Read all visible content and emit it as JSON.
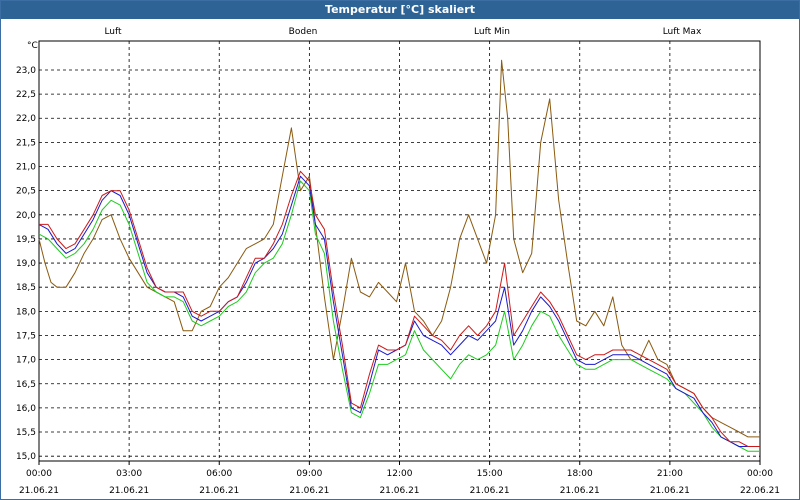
{
  "window": {
    "title": "Temperatur [°C] skaliert"
  },
  "colors": {
    "luft": "#1a1acc",
    "boden": "#8a5a10",
    "luft_min": "#1ecc1e",
    "luft_max": "#cc1a1a",
    "grid": "#000000",
    "title_bar": "#2e6396"
  },
  "chart_data": {
    "type": "line",
    "title": "Temperatur [°C] skaliert",
    "ylabel": "°C",
    "xlabel": "",
    "ylim": [
      14.9,
      23.6
    ],
    "xlim": [
      0,
      24
    ],
    "grid": true,
    "legend": "top",
    "y_ticks": [
      "15,0",
      "15,5",
      "16,0",
      "16,5",
      "17,0",
      "17,5",
      "18,0",
      "18,5",
      "19,0",
      "19,5",
      "20,0",
      "20,5",
      "21,0",
      "21,5",
      "22,0",
      "22,5",
      "23,0"
    ],
    "y_tick_values": [
      15,
      15.5,
      16,
      16.5,
      17,
      17.5,
      18,
      18.5,
      19,
      19.5,
      20,
      20.5,
      21,
      21.5,
      22,
      22.5,
      23
    ],
    "x_ticks": [
      {
        "value": 0,
        "time": "00:00",
        "date": "21.06.21"
      },
      {
        "value": 3,
        "time": "03:00",
        "date": "21.06.21"
      },
      {
        "value": 6,
        "time": "06:00",
        "date": "21.06.21"
      },
      {
        "value": 9,
        "time": "09:00",
        "date": "21.06.21"
      },
      {
        "value": 12,
        "time": "12:00",
        "date": "21.06.21"
      },
      {
        "value": 15,
        "time": "15:00",
        "date": "21.06.21"
      },
      {
        "value": 18,
        "time": "18:00",
        "date": "21.06.21"
      },
      {
        "value": 21,
        "time": "21:00",
        "date": "21.06.21"
      },
      {
        "value": 24,
        "time": "00:00",
        "date": "22.06.21"
      }
    ],
    "series": [
      {
        "name": "Luft",
        "key": "luft",
        "x": [
          0,
          0.3,
          0.6,
          0.9,
          1.2,
          1.5,
          1.8,
          2.1,
          2.4,
          2.7,
          3.0,
          3.3,
          3.6,
          3.9,
          4.2,
          4.5,
          4.8,
          5.1,
          5.4,
          5.7,
          6.0,
          6.3,
          6.6,
          6.9,
          7.2,
          7.5,
          7.8,
          8.1,
          8.4,
          8.7,
          9.0,
          9.2,
          9.5,
          9.8,
          10.1,
          10.4,
          10.7,
          11.0,
          11.3,
          11.6,
          11.9,
          12.2,
          12.5,
          12.8,
          13.1,
          13.4,
          13.7,
          14.0,
          14.3,
          14.6,
          14.9,
          15.2,
          15.5,
          15.8,
          16.1,
          16.4,
          16.7,
          17.0,
          17.3,
          17.6,
          17.9,
          18.2,
          18.5,
          18.8,
          19.1,
          19.4,
          19.7,
          20.0,
          20.3,
          20.6,
          20.9,
          21.2,
          21.5,
          21.8,
          22.1,
          22.4,
          22.7,
          23.0,
          23.3,
          23.6,
          24.0
        ],
        "values": [
          19.8,
          19.7,
          19.4,
          19.2,
          19.3,
          19.6,
          19.9,
          20.3,
          20.5,
          20.4,
          20.0,
          19.4,
          18.8,
          18.5,
          18.4,
          18.4,
          18.3,
          17.9,
          17.8,
          17.9,
          18.0,
          18.2,
          18.3,
          18.6,
          19.0,
          19.1,
          19.3,
          19.6,
          20.2,
          20.8,
          20.6,
          19.8,
          19.5,
          18.2,
          17.1,
          16.0,
          15.9,
          16.5,
          17.2,
          17.1,
          17.2,
          17.3,
          17.8,
          17.5,
          17.4,
          17.3,
          17.1,
          17.3,
          17.5,
          17.4,
          17.6,
          17.8,
          18.5,
          17.3,
          17.6,
          18.0,
          18.3,
          18.1,
          17.8,
          17.4,
          17.0,
          16.9,
          16.9,
          17.0,
          17.1,
          17.1,
          17.1,
          17.0,
          16.9,
          16.8,
          16.7,
          16.4,
          16.3,
          16.2,
          15.9,
          15.7,
          15.4,
          15.3,
          15.2,
          15.2,
          15.2
        ]
      },
      {
        "name": "Boden",
        "key": "boden",
        "x": [
          0,
          0.2,
          0.4,
          0.6,
          0.9,
          1.2,
          1.5,
          1.8,
          2.1,
          2.4,
          2.7,
          3.0,
          3.3,
          3.6,
          3.9,
          4.2,
          4.5,
          4.8,
          5.1,
          5.4,
          5.7,
          6.0,
          6.3,
          6.6,
          6.9,
          7.2,
          7.5,
          7.8,
          8.1,
          8.4,
          8.7,
          9.0,
          9.2,
          9.5,
          9.8,
          10.1,
          10.4,
          10.7,
          11.0,
          11.3,
          11.6,
          11.9,
          12.2,
          12.5,
          12.8,
          13.1,
          13.4,
          13.7,
          14.0,
          14.3,
          14.6,
          14.9,
          15.2,
          15.4,
          15.6,
          15.8,
          16.1,
          16.4,
          16.7,
          17.0,
          17.3,
          17.6,
          17.9,
          18.2,
          18.5,
          18.8,
          19.1,
          19.4,
          19.7,
          20.0,
          20.3,
          20.6,
          20.9,
          21.2,
          21.5,
          21.8,
          22.1,
          22.4,
          22.7,
          23.0,
          23.3,
          23.6,
          24.0
        ],
        "values": [
          19.5,
          19.0,
          18.6,
          18.5,
          18.5,
          18.8,
          19.2,
          19.5,
          19.9,
          20.0,
          19.5,
          19.1,
          18.8,
          18.5,
          18.4,
          18.3,
          18.2,
          17.6,
          17.6,
          18.0,
          18.1,
          18.5,
          18.7,
          19.0,
          19.3,
          19.4,
          19.5,
          19.8,
          20.8,
          21.8,
          20.5,
          20.8,
          19.8,
          18.3,
          17.0,
          18.0,
          19.1,
          18.4,
          18.3,
          18.6,
          18.4,
          18.2,
          19.0,
          18.0,
          17.8,
          17.5,
          17.8,
          18.5,
          19.5,
          20.0,
          19.5,
          19.0,
          20.0,
          23.2,
          22.0,
          19.5,
          18.8,
          19.2,
          21.5,
          22.4,
          20.3,
          19.0,
          17.8,
          17.7,
          18.0,
          17.7,
          18.3,
          17.3,
          17.0,
          17.0,
          17.4,
          17.0,
          16.9,
          16.5,
          16.4,
          16.3,
          16.0,
          15.8,
          15.7,
          15.6,
          15.5,
          15.4,
          15.4
        ]
      },
      {
        "name": "Luft Min",
        "key": "luft_min",
        "x": [
          0,
          0.3,
          0.6,
          0.9,
          1.2,
          1.5,
          1.8,
          2.1,
          2.4,
          2.7,
          3.0,
          3.3,
          3.6,
          3.9,
          4.2,
          4.5,
          4.8,
          5.1,
          5.4,
          5.7,
          6.0,
          6.3,
          6.6,
          6.9,
          7.2,
          7.5,
          7.8,
          8.1,
          8.4,
          8.7,
          9.0,
          9.2,
          9.5,
          9.8,
          10.1,
          10.4,
          10.7,
          11.0,
          11.3,
          11.6,
          11.9,
          12.2,
          12.5,
          12.8,
          13.1,
          13.4,
          13.7,
          14.0,
          14.3,
          14.6,
          14.9,
          15.2,
          15.5,
          15.8,
          16.1,
          16.4,
          16.7,
          17.0,
          17.3,
          17.6,
          17.9,
          18.2,
          18.5,
          18.8,
          19.1,
          19.4,
          19.7,
          20.0,
          20.3,
          20.6,
          20.9,
          21.2,
          21.5,
          21.8,
          22.1,
          22.4,
          22.7,
          23.0,
          23.3,
          23.6,
          24.0
        ],
        "values": [
          19.6,
          19.5,
          19.3,
          19.1,
          19.2,
          19.4,
          19.7,
          20.1,
          20.3,
          20.2,
          19.8,
          19.2,
          18.6,
          18.4,
          18.3,
          18.3,
          18.2,
          17.8,
          17.7,
          17.8,
          17.9,
          18.1,
          18.2,
          18.4,
          18.8,
          19.0,
          19.1,
          19.4,
          20.0,
          20.7,
          20.5,
          19.6,
          19.2,
          17.8,
          16.8,
          15.9,
          15.8,
          16.3,
          16.9,
          16.9,
          17.0,
          17.1,
          17.6,
          17.2,
          17.0,
          16.8,
          16.6,
          16.9,
          17.1,
          17.0,
          17.1,
          17.3,
          18.0,
          17.0,
          17.3,
          17.7,
          18.0,
          17.9,
          17.5,
          17.2,
          16.9,
          16.8,
          16.8,
          16.9,
          17.0,
          17.0,
          17.0,
          16.9,
          16.8,
          16.7,
          16.6,
          16.4,
          16.3,
          16.1,
          15.9,
          15.6,
          15.4,
          15.3,
          15.2,
          15.1,
          15.1
        ]
      },
      {
        "name": "Luft Max",
        "key": "luft_max",
        "x": [
          0,
          0.3,
          0.6,
          0.9,
          1.2,
          1.5,
          1.8,
          2.1,
          2.4,
          2.7,
          3.0,
          3.3,
          3.6,
          3.9,
          4.2,
          4.5,
          4.8,
          5.1,
          5.4,
          5.7,
          6.0,
          6.3,
          6.6,
          6.9,
          7.2,
          7.5,
          7.8,
          8.1,
          8.4,
          8.7,
          9.0,
          9.2,
          9.5,
          9.8,
          10.1,
          10.4,
          10.7,
          11.0,
          11.3,
          11.6,
          11.9,
          12.2,
          12.5,
          12.8,
          13.1,
          13.4,
          13.7,
          14.0,
          14.3,
          14.6,
          14.9,
          15.2,
          15.5,
          15.8,
          16.1,
          16.4,
          16.7,
          17.0,
          17.3,
          17.6,
          17.9,
          18.2,
          18.5,
          18.8,
          19.1,
          19.4,
          19.7,
          20.0,
          20.3,
          20.6,
          20.9,
          21.2,
          21.5,
          21.8,
          22.1,
          22.4,
          22.7,
          23.0,
          23.3,
          23.6,
          24.0
        ],
        "values": [
          19.8,
          19.8,
          19.5,
          19.3,
          19.4,
          19.7,
          20.0,
          20.4,
          20.5,
          20.5,
          20.1,
          19.5,
          18.9,
          18.5,
          18.4,
          18.4,
          18.4,
          18.0,
          17.9,
          18.0,
          18.0,
          18.2,
          18.3,
          18.7,
          19.1,
          19.1,
          19.4,
          19.8,
          20.4,
          20.9,
          20.7,
          20.0,
          19.7,
          18.4,
          17.3,
          16.1,
          16.0,
          16.7,
          17.3,
          17.2,
          17.2,
          17.3,
          17.9,
          17.7,
          17.5,
          17.4,
          17.2,
          17.5,
          17.7,
          17.5,
          17.7,
          18.0,
          19.0,
          17.5,
          17.8,
          18.1,
          18.4,
          18.2,
          17.9,
          17.5,
          17.1,
          17.0,
          17.1,
          17.1,
          17.2,
          17.2,
          17.2,
          17.1,
          17.0,
          16.9,
          16.8,
          16.5,
          16.4,
          16.3,
          16.0,
          15.8,
          15.5,
          15.3,
          15.3,
          15.2,
          15.2
        ]
      }
    ]
  }
}
